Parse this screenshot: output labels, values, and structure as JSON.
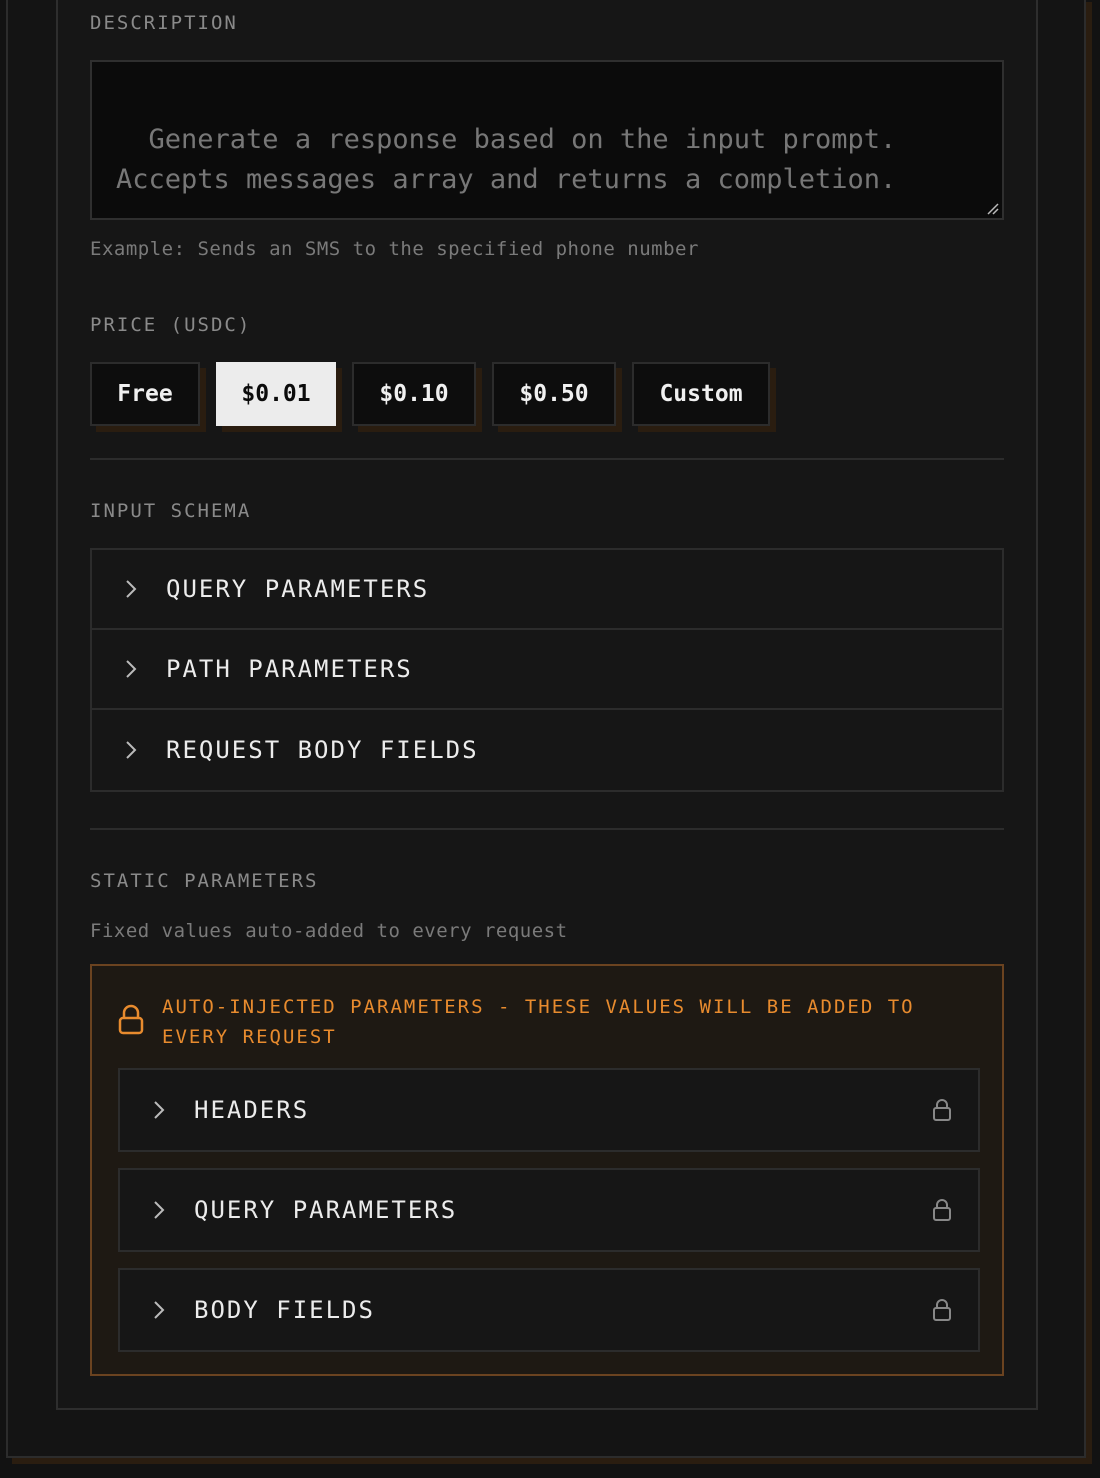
{
  "description": {
    "label": "DESCRIPTION",
    "placeholder": "Generate a response based on the input prompt.\nAccepts messages array and returns a completion.",
    "hint": "Example: Sends an SMS to the specified phone number"
  },
  "price": {
    "label": "PRICE (USDC)",
    "options": [
      "Free",
      "$0.01",
      "$0.10",
      "$0.50",
      "Custom"
    ],
    "selected": "$0.01"
  },
  "input_schema": {
    "label": "INPUT SCHEMA",
    "sections": [
      "QUERY PARAMETERS",
      "PATH PARAMETERS",
      "REQUEST BODY FIELDS"
    ]
  },
  "static_parameters": {
    "label": "STATIC PARAMETERS",
    "hint": "Fixed values auto-added to every request",
    "warning": "AUTO-INJECTED PARAMETERS - THESE VALUES WILL BE ADDED TO EVERY REQUEST",
    "sections": [
      "HEADERS",
      "QUERY PARAMETERS",
      "BODY FIELDS"
    ]
  },
  "colors": {
    "accent": "#e88b2e",
    "selected_bg": "#ececec",
    "background": "#121212"
  }
}
